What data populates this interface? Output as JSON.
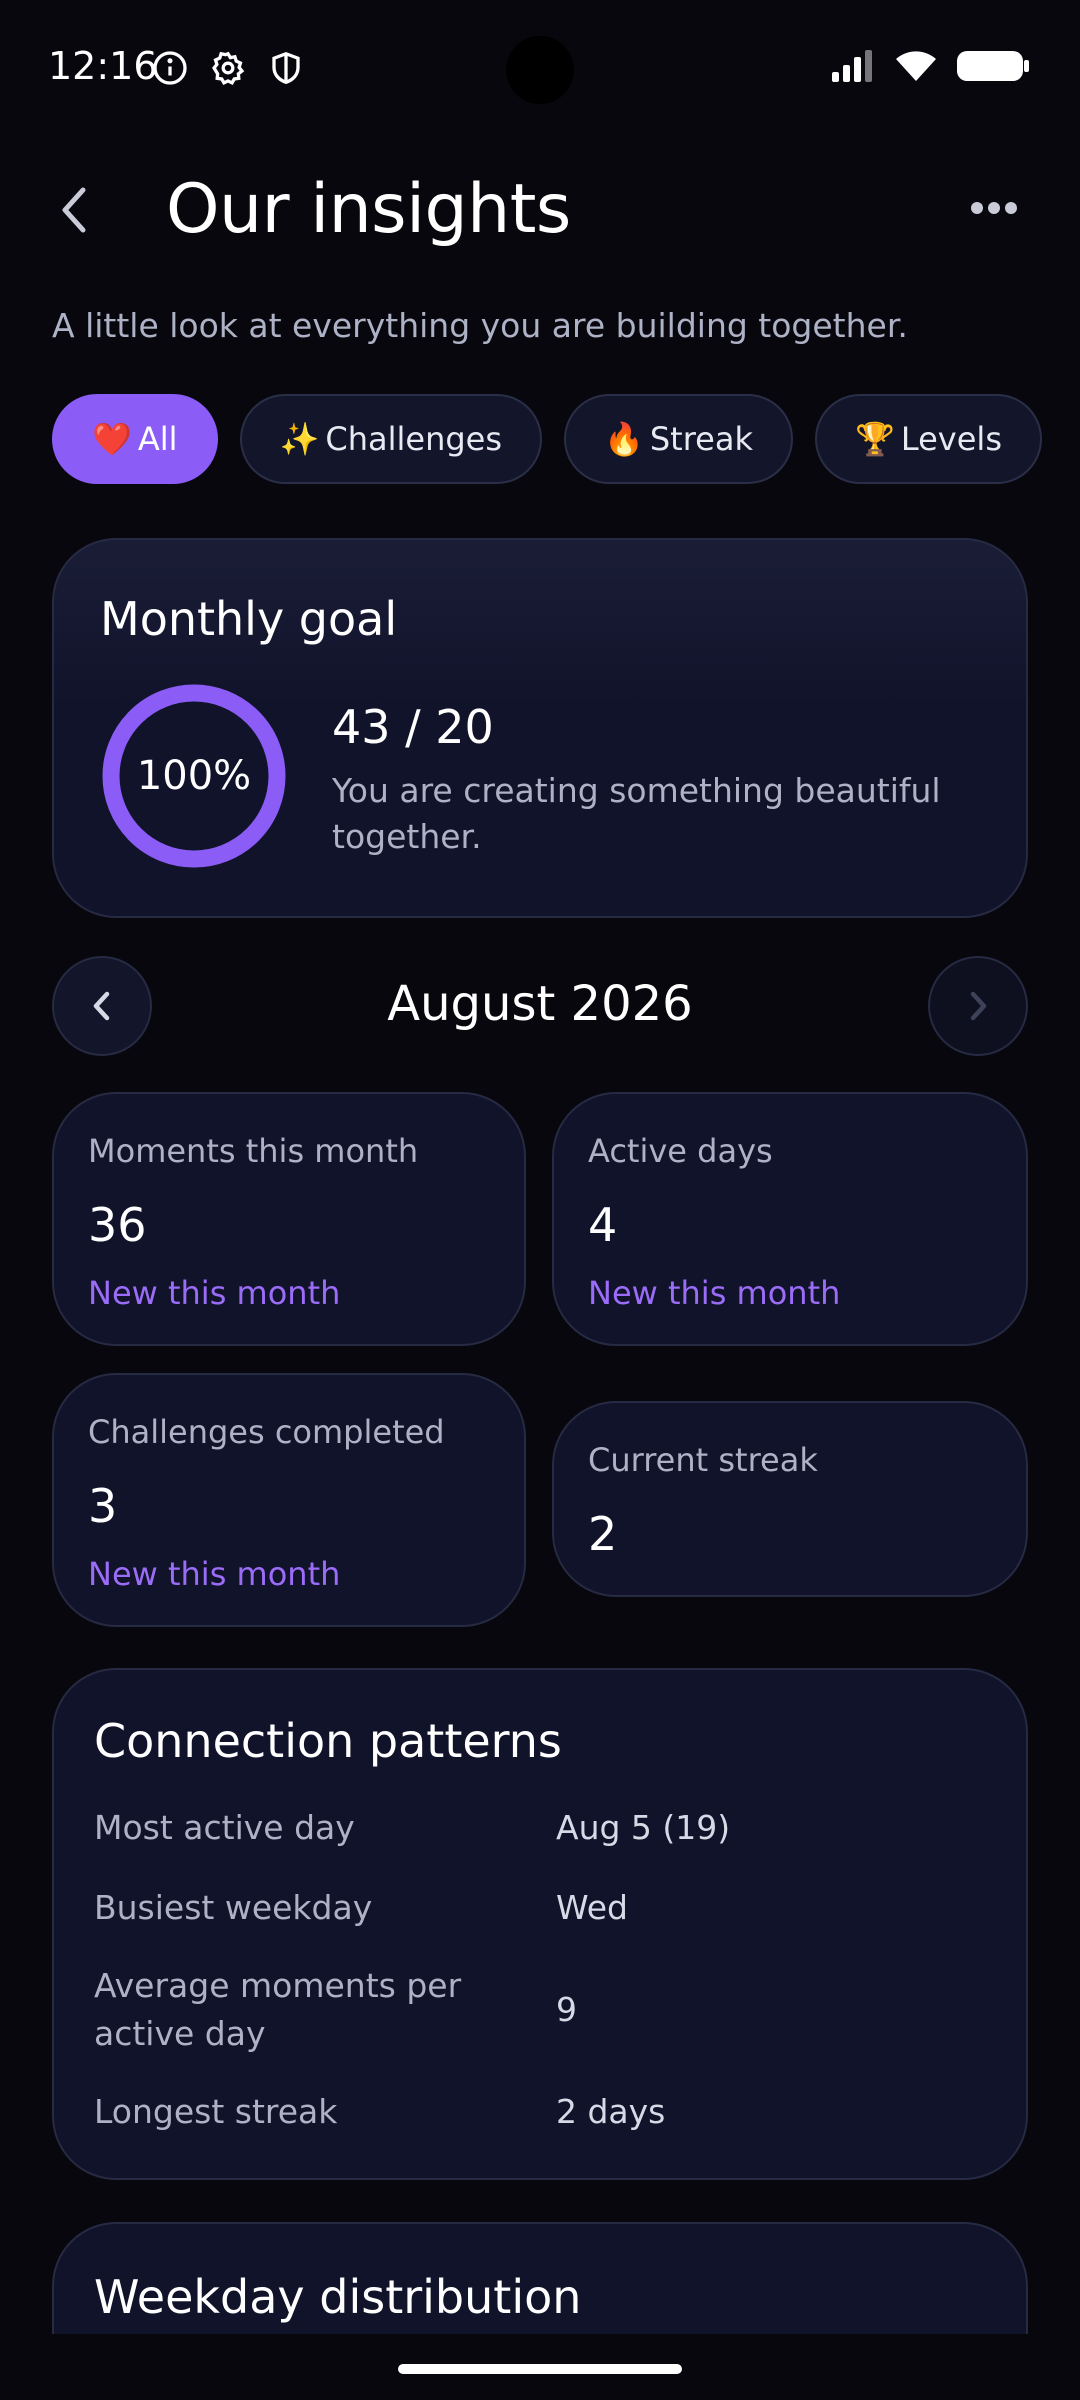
{
  "status_bar": {
    "time": "12:16"
  },
  "header": {
    "title": "Our insights",
    "subtitle": "A little look at everything you are building together."
  },
  "filters": [
    {
      "emoji": "❤️",
      "label": "All",
      "active": true
    },
    {
      "emoji": "✨",
      "label": "Challenges",
      "active": false
    },
    {
      "emoji": "🔥",
      "label": "Streak",
      "active": false
    },
    {
      "emoji": "🏆",
      "label": "Levels",
      "active": false
    }
  ],
  "monthly_goal": {
    "title": "Monthly goal",
    "percent_label": "100%",
    "progress": 1.0,
    "count": "43 / 20",
    "message": "You are creating something beautiful together."
  },
  "month_nav": {
    "label": "August 2026"
  },
  "stats": [
    {
      "label": "Moments this month",
      "value": "36",
      "note": "New this month"
    },
    {
      "label": "Active days",
      "value": "4",
      "note": "New this month"
    },
    {
      "label": "Challenges completed",
      "value": "3",
      "note": "New this month"
    },
    {
      "label": "Current streak",
      "value": "2"
    }
  ],
  "patterns": {
    "title": "Connection patterns",
    "rows": [
      {
        "label": "Most active day",
        "value": "Aug 5 (19)"
      },
      {
        "label": "Busiest weekday",
        "value": "Wed"
      },
      {
        "label": "Average moments per active day",
        "value": "9"
      },
      {
        "label": "Longest streak",
        "value": "2 days"
      }
    ]
  },
  "weekday_distribution": {
    "title": "Weekday distribution"
  },
  "colors": {
    "accent": "#8b5cf6",
    "background": "#07070d",
    "card": "#10132a",
    "muted_text": "#aeb2c6"
  }
}
